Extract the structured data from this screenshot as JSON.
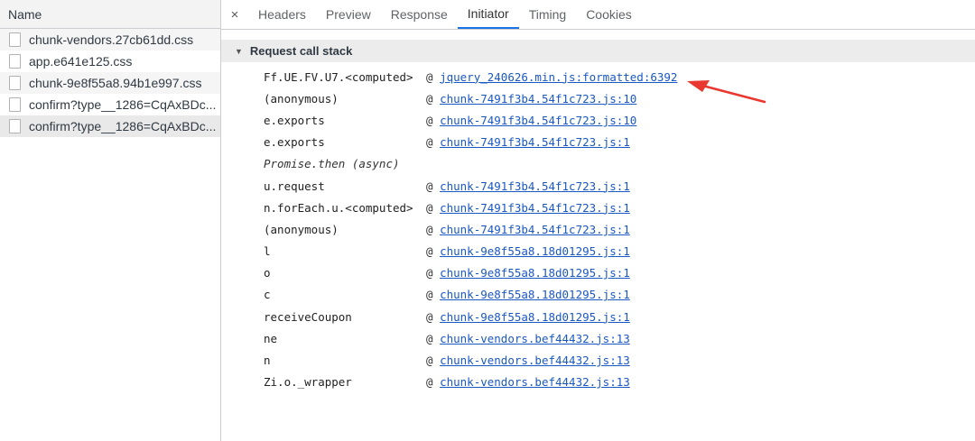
{
  "requests": {
    "header": "Name",
    "items": [
      {
        "name": "chunk-vendors.27cb61dd.css"
      },
      {
        "name": "app.e641e125.css"
      },
      {
        "name": "chunk-9e8f55a8.94b1e997.css"
      },
      {
        "name": "confirm?type__1286=CqAxBDc..."
      },
      {
        "name": "confirm?type__1286=CqAxBDc..."
      }
    ]
  },
  "tabs": {
    "close": "×",
    "labels": [
      "Headers",
      "Preview",
      "Response",
      "Initiator",
      "Timing",
      "Cookies"
    ],
    "active": "Initiator"
  },
  "call_stack": {
    "title": "Request call stack",
    "frames": [
      {
        "fn": "Ff.UE.FV.U7.<computed>",
        "at": "@",
        "loc": "jquery_240626.min.js:formatted:6392"
      },
      {
        "fn": "(anonymous)",
        "at": "@",
        "loc": "chunk-7491f3b4.54f1c723.js:10"
      },
      {
        "fn": "e.exports",
        "at": "@",
        "loc": "chunk-7491f3b4.54f1c723.js:10"
      },
      {
        "fn": "e.exports",
        "at": "@",
        "loc": "chunk-7491f3b4.54f1c723.js:1"
      },
      {
        "fn": "Promise.then (async)",
        "at": "",
        "loc": ""
      },
      {
        "fn": "u.request",
        "at": "@",
        "loc": "chunk-7491f3b4.54f1c723.js:1"
      },
      {
        "fn": "n.forEach.u.<computed>",
        "at": "@",
        "loc": "chunk-7491f3b4.54f1c723.js:1"
      },
      {
        "fn": "(anonymous)",
        "at": "@",
        "loc": "chunk-7491f3b4.54f1c723.js:1"
      },
      {
        "fn": "l",
        "at": "@",
        "loc": "chunk-9e8f55a8.18d01295.js:1"
      },
      {
        "fn": "o",
        "at": "@",
        "loc": "chunk-9e8f55a8.18d01295.js:1"
      },
      {
        "fn": "c",
        "at": "@",
        "loc": "chunk-9e8f55a8.18d01295.js:1"
      },
      {
        "fn": "receiveCoupon",
        "at": "@",
        "loc": "chunk-9e8f55a8.18d01295.js:1"
      },
      {
        "fn": "ne",
        "at": "@",
        "loc": "chunk-vendors.bef44432.js:13"
      },
      {
        "fn": "n",
        "at": "@",
        "loc": "chunk-vendors.bef44432.js:13"
      },
      {
        "fn": "Zi.o._wrapper",
        "at": "@",
        "loc": "chunk-vendors.bef44432.js:13"
      }
    ]
  },
  "annotation": {
    "arrow_color": "#e8382f"
  },
  "colors": {
    "link": "#1a58c4",
    "active_tab": "#1a73e8"
  }
}
